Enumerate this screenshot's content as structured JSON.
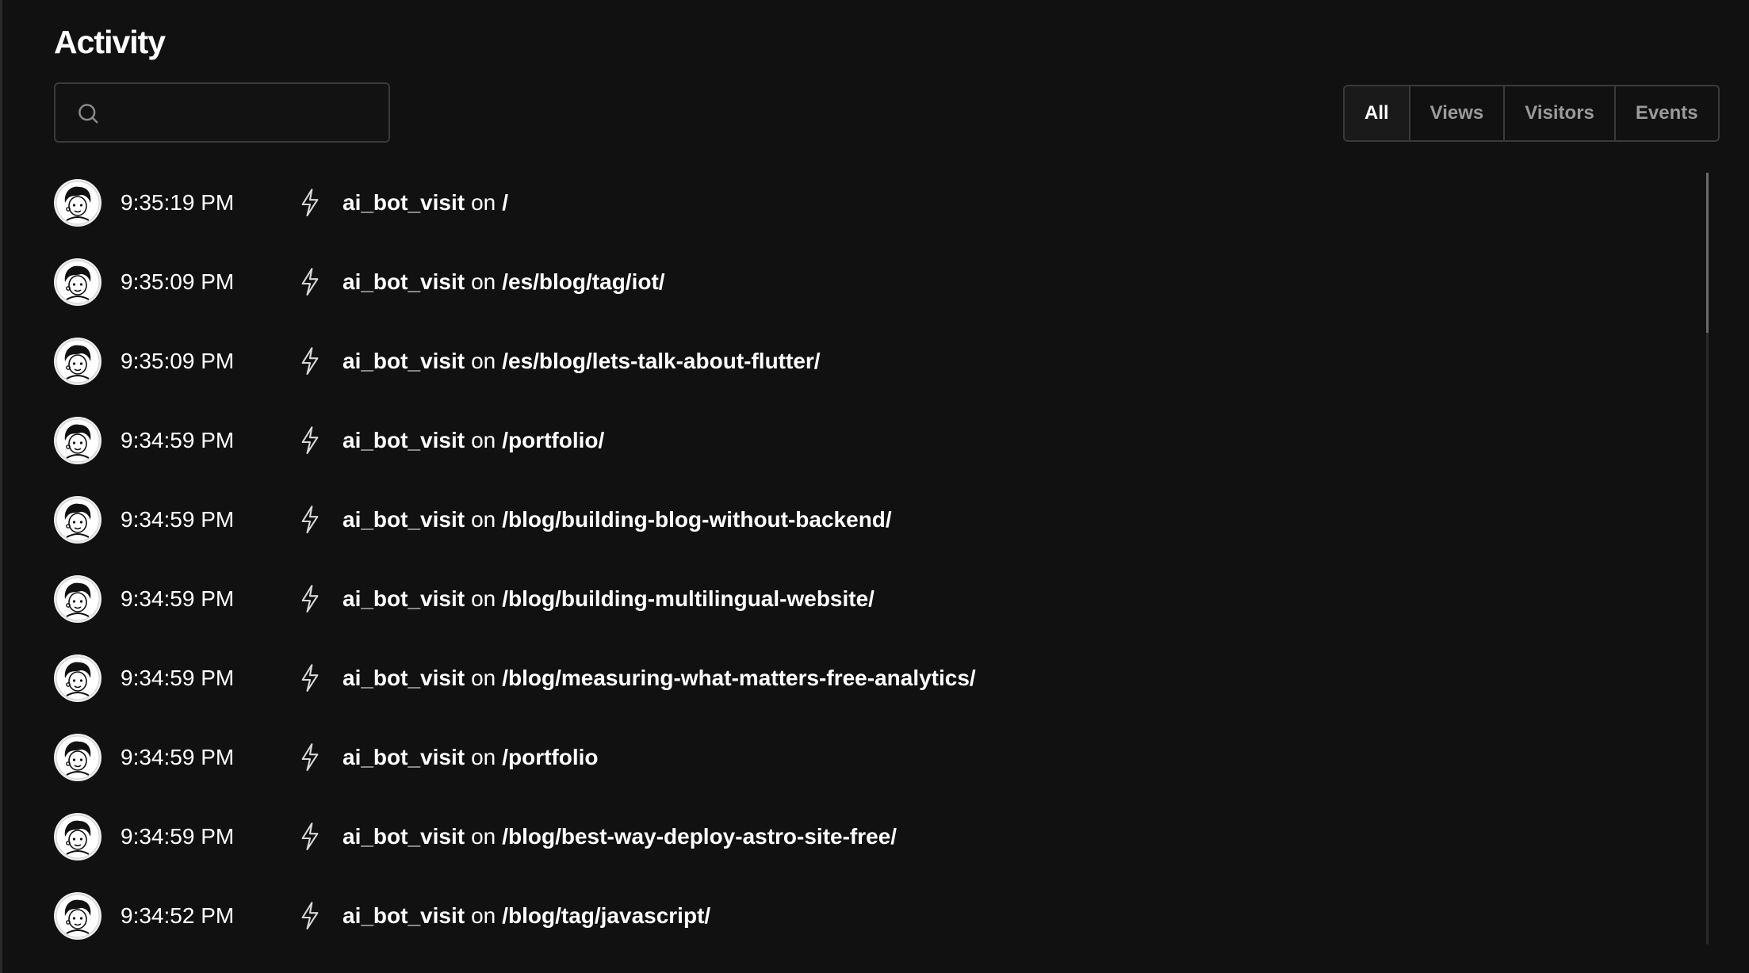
{
  "page": {
    "title": "Activity"
  },
  "search": {
    "value": "",
    "icon": "search-icon"
  },
  "filters": [
    {
      "label": "All",
      "active": true
    },
    {
      "label": "Views",
      "active": false
    },
    {
      "label": "Visitors",
      "active": false
    },
    {
      "label": "Events",
      "active": false
    }
  ],
  "activity": {
    "connector": "on",
    "event_icon": "lightning-bolt-icon",
    "items": [
      {
        "time": "9:35:19 PM",
        "event": "ai_bot_visit",
        "path": "/"
      },
      {
        "time": "9:35:09 PM",
        "event": "ai_bot_visit",
        "path": "/es/blog/tag/iot/"
      },
      {
        "time": "9:35:09 PM",
        "event": "ai_bot_visit",
        "path": "/es/blog/lets-talk-about-flutter/"
      },
      {
        "time": "9:34:59 PM",
        "event": "ai_bot_visit",
        "path": "/portfolio/"
      },
      {
        "time": "9:34:59 PM",
        "event": "ai_bot_visit",
        "path": "/blog/building-blog-without-backend/"
      },
      {
        "time": "9:34:59 PM",
        "event": "ai_bot_visit",
        "path": "/blog/building-multilingual-website/"
      },
      {
        "time": "9:34:59 PM",
        "event": "ai_bot_visit",
        "path": "/blog/measuring-what-matters-free-analytics/"
      },
      {
        "time": "9:34:59 PM",
        "event": "ai_bot_visit",
        "path": "/portfolio"
      },
      {
        "time": "9:34:59 PM",
        "event": "ai_bot_visit",
        "path": "/blog/best-way-deploy-astro-site-free/"
      },
      {
        "time": "9:34:52 PM",
        "event": "ai_bot_visit",
        "path": "/blog/tag/javascript/"
      }
    ]
  },
  "colors": {
    "background": "#111111",
    "border": "#3a3a3a",
    "text": "#ffffff",
    "muted": "#9a9a9a"
  }
}
